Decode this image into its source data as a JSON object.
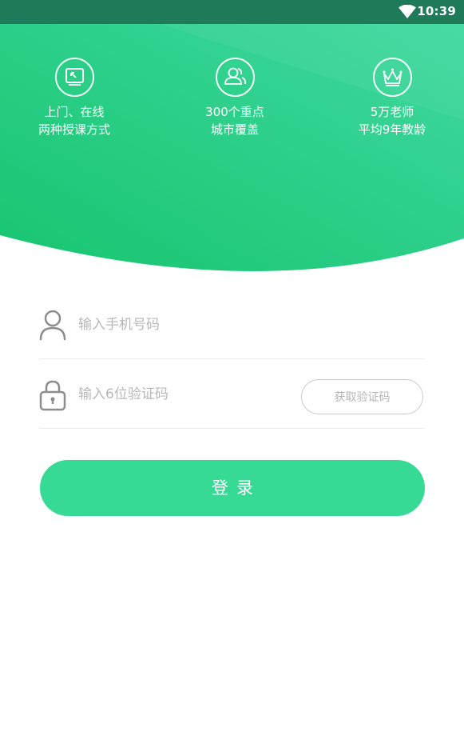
{
  "status_bar": {
    "time": "10:39",
    "icons": [
      "wifi-icon"
    ]
  },
  "hero": {
    "colors": {
      "from": "#17c56f",
      "to": "#3fd8a0"
    },
    "features": [
      {
        "icon": "screen-icon",
        "line1": "上门、在线",
        "line2": "两种授课方式"
      },
      {
        "icon": "users-icon",
        "line1": "300个重点",
        "line2": "城市覆盖"
      },
      {
        "icon": "crown-icon",
        "line1": "5万老师",
        "line2": "平均9年教龄"
      }
    ]
  },
  "form": {
    "phone_placeholder": "输入手机号码",
    "code_placeholder": "输入6位验证码",
    "get_code_label": "获取验证码",
    "login_label": "登录",
    "accent": "#36da95"
  }
}
